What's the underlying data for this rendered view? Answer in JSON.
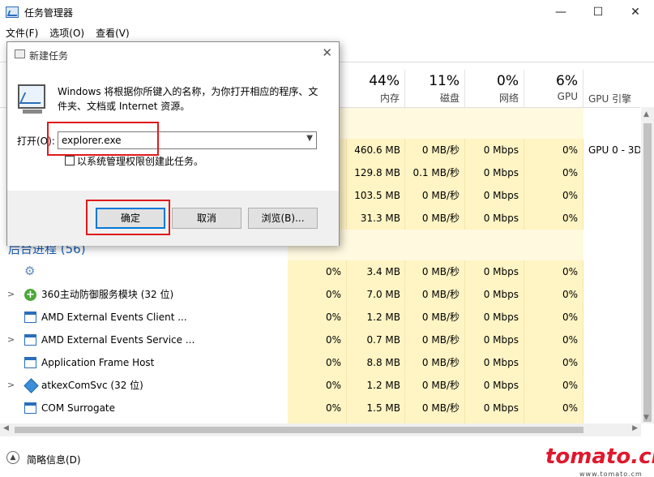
{
  "window": {
    "title": "任务管理器",
    "minimize": "—",
    "maximize": "☐",
    "close": "✕"
  },
  "menu": [
    "文件(F)",
    "选项(O)",
    "查看(V)"
  ],
  "columns": [
    {
      "pct": "44%",
      "label": "内存"
    },
    {
      "pct": "11%",
      "label": "磁盘"
    },
    {
      "pct": "0%",
      "label": "网络"
    },
    {
      "pct": "6%",
      "label": "GPU"
    }
  ],
  "gpu_engine_label": "GPU 引擎",
  "apps_rows": [
    {
      "cpu": "",
      "mem": "460.6 MB",
      "disk": "0 MB/秒",
      "net": "0 Mbps",
      "gpu": "0%",
      "gpueng": "GPU 0 - 3D"
    },
    {
      "cpu": "",
      "mem": "129.8 MB",
      "disk": "0.1 MB/秒",
      "net": "0 Mbps",
      "gpu": "0%",
      "gpueng": ""
    },
    {
      "cpu": "",
      "mem": "103.5 MB",
      "disk": "0 MB/秒",
      "net": "0 Mbps",
      "gpu": "0%",
      "gpueng": ""
    },
    {
      "cpu": "",
      "mem": "31.3 MB",
      "disk": "0 MB/秒",
      "net": "0 Mbps",
      "gpu": "0%",
      "gpueng": ""
    }
  ],
  "background_section": "后台进程 (56)",
  "background_rows": [
    {
      "name": "",
      "icon": "gear-icon",
      "chevron": false,
      "cpu": "0%",
      "mem": "3.4 MB",
      "disk": "0 MB/秒",
      "net": "0 Mbps",
      "gpu": "0%"
    },
    {
      "name": "360主动防御服务模块 (32 位)",
      "icon": "shield-icon",
      "chevron": true,
      "cpu": "0%",
      "mem": "7.0 MB",
      "disk": "0 MB/秒",
      "net": "0 Mbps",
      "gpu": "0%"
    },
    {
      "name": "AMD External Events Client ...",
      "icon": "app-window-icon",
      "chevron": false,
      "cpu": "0%",
      "mem": "1.2 MB",
      "disk": "0 MB/秒",
      "net": "0 Mbps",
      "gpu": "0%"
    },
    {
      "name": "AMD External Events Service ...",
      "icon": "app-window-icon",
      "chevron": true,
      "cpu": "0%",
      "mem": "0.7 MB",
      "disk": "0 MB/秒",
      "net": "0 Mbps",
      "gpu": "0%"
    },
    {
      "name": "Application Frame Host",
      "icon": "app-window-icon",
      "chevron": false,
      "cpu": "0%",
      "mem": "8.8 MB",
      "disk": "0 MB/秒",
      "net": "0 Mbps",
      "gpu": "0%"
    },
    {
      "name": "atkexComSvc (32 位)",
      "icon": "diamond-icon",
      "chevron": true,
      "cpu": "0%",
      "mem": "1.2 MB",
      "disk": "0 MB/秒",
      "net": "0 Mbps",
      "gpu": "0%"
    },
    {
      "name": "COM Surrogate",
      "icon": "app-window-icon",
      "chevron": false,
      "cpu": "0%",
      "mem": "1.5 MB",
      "disk": "0 MB/秒",
      "net": "0 Mbps",
      "gpu": "0%"
    }
  ],
  "footer": {
    "label": "简略信息(D)"
  },
  "watermark": {
    "text": "tomato.cm",
    "sub": "www.tomato.cm"
  },
  "dialog": {
    "title": "新建任务",
    "description": "Windows 将根据你所键入的名称，为你打开相应的程序、文件夹、文档或 Internet 资源。",
    "open_label": "打开(O):",
    "input_value": "explorer.exe",
    "admin_checkbox": "以系统管理权限创建此任务。",
    "ok": "确定",
    "cancel": "取消",
    "browse": "浏览(B)..."
  },
  "colors": {
    "highlight": "#e01a1a",
    "usage_yellow": "#fff4c4",
    "section_blue": "#1a5fb4",
    "accent": "#0078d7"
  }
}
